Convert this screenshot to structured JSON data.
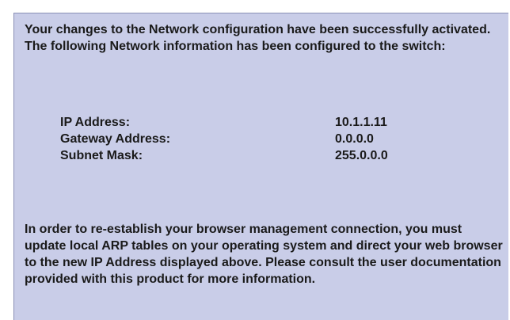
{
  "message": {
    "intro": "Your changes to the Network configuration have been successfully activated.  The following Network information has been configured to the switch:",
    "outro": "In order to re-establish your browser management connection, you must update local ARP tables on your operating system and direct your web browser to the new IP Address displayed above.  Please consult the user documentation provided with this product for more information."
  },
  "network_info": [
    {
      "label": "IP Address:",
      "value": "10.1.1.11"
    },
    {
      "label": "Gateway Address:",
      "value": "0.0.0.0"
    },
    {
      "label": "Subnet Mask:",
      "value": "255.0.0.0"
    }
  ],
  "colors": {
    "panel_background": "#c9cde8",
    "panel_border": "#8a8fb5",
    "text": "#1a1a1a"
  }
}
